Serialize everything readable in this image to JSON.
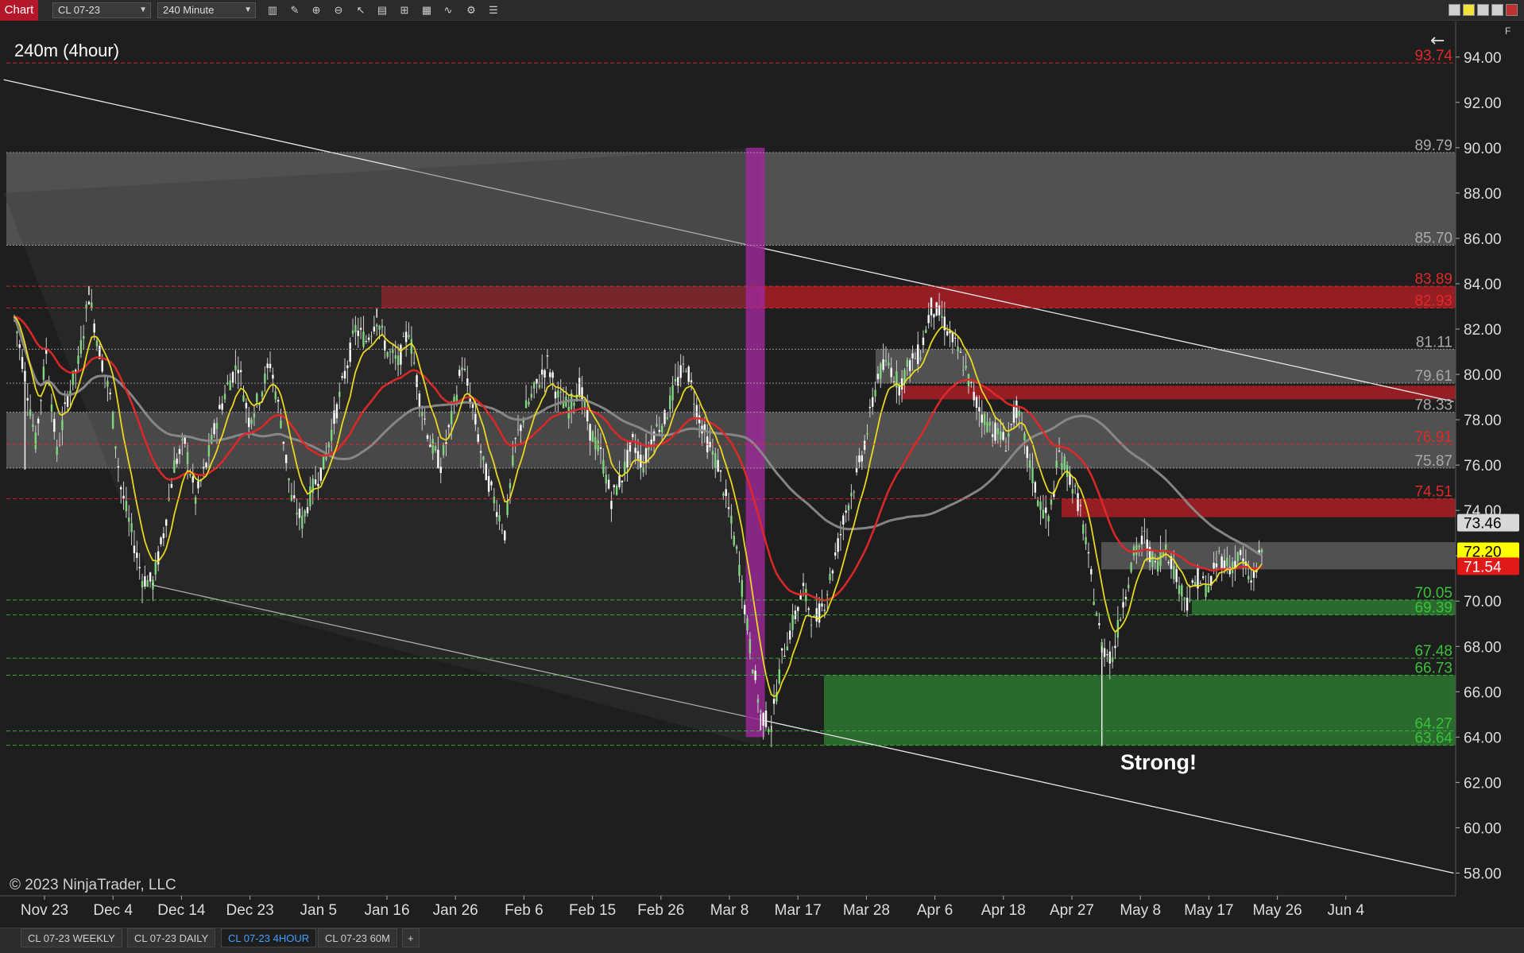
{
  "toolbar": {
    "tab_label": "Chart",
    "instrument": "CL 07-23",
    "interval": "240 Minute",
    "icons": [
      "bar-type-icon",
      "pencil-icon",
      "zoom-in-icon",
      "zoom-out-icon",
      "pointer-icon",
      "properties-icon",
      "templates-icon",
      "data-box-icon",
      "indicators-icon",
      "strategies-icon",
      "list-icon"
    ],
    "window_buttons": [
      "minimize-icon",
      "maximize-icon",
      "restore-icon",
      "close-icon"
    ]
  },
  "chart_title": "240m (4hour)",
  "copyright": "© 2023 NinjaTrader, LLC",
  "annotation": "Strong!",
  "panel_flag": "F",
  "back_icon": "back-arrow-icon",
  "colors": {
    "background": "#1e1e1e",
    "resistance": "#c81e28",
    "support": "#2e7d32",
    "neutral_zone": "#5a5a5a",
    "ema_fast": "#f0e020",
    "ema_mid": "#e02828",
    "sma_slow": "#8a8a8a",
    "highlight_bar": "#a0289c",
    "up_candle": "#7ed67e",
    "down_candle": "#ffffff"
  },
  "chart_data": {
    "type": "candlestick",
    "title": "240m (4hour)",
    "ylim": [
      57,
      95.5
    ],
    "y_ticks": [
      58,
      60,
      62,
      64,
      66,
      68,
      70,
      72,
      74,
      76,
      78,
      80,
      82,
      84,
      86,
      88,
      90,
      92,
      94
    ],
    "y_tick_labels": [
      "58.00",
      "60.00",
      "62.00",
      "64.00",
      "66.00",
      "68.00",
      "70.00",
      "72.00",
      "74.00",
      "76.00",
      "78.00",
      "80.00",
      "82.00",
      "84.00",
      "86.00",
      "88.00",
      "90.00",
      "92.00",
      "94.00"
    ],
    "x_tick_labels": [
      "Nov 23",
      "Dec 4",
      "Dec 14",
      "Dec 23",
      "Jan 5",
      "Jan 16",
      "Jan 26",
      "Feb 6",
      "Feb 15",
      "Feb 26",
      "Mar 8",
      "Mar 17",
      "Mar 28",
      "Apr 6",
      "Apr 18",
      "Apr 27",
      "May 8",
      "May 17",
      "May 26",
      "Jun 4"
    ],
    "price_path": [
      [
        0,
        82.5
      ],
      [
        2,
        80
      ],
      [
        4,
        77
      ],
      [
        6,
        81
      ],
      [
        8,
        76.5
      ],
      [
        10,
        79
      ],
      [
        12,
        80.5
      ],
      [
        14,
        83.5
      ],
      [
        16,
        81
      ],
      [
        18,
        79
      ],
      [
        20,
        75
      ],
      [
        22,
        73
      ],
      [
        24,
        71
      ],
      [
        26,
        70.8
      ],
      [
        28,
        73
      ],
      [
        30,
        76
      ],
      [
        32,
        77
      ],
      [
        34,
        74.5
      ],
      [
        36,
        76
      ],
      [
        38,
        78
      ],
      [
        40,
        79.5
      ],
      [
        42,
        80.5
      ],
      [
        44,
        78
      ],
      [
        46,
        79
      ],
      [
        48,
        80.5
      ],
      [
        50,
        78
      ],
      [
        52,
        74.5
      ],
      [
        54,
        73.5
      ],
      [
        56,
        75
      ],
      [
        58,
        76
      ],
      [
        60,
        78
      ],
      [
        62,
        80
      ],
      [
        64,
        82
      ],
      [
        66,
        81.5
      ],
      [
        68,
        82.5
      ],
      [
        70,
        81
      ],
      [
        72,
        80.5
      ],
      [
        74,
        82
      ],
      [
        76,
        79
      ],
      [
        78,
        77
      ],
      [
        80,
        76
      ],
      [
        82,
        78
      ],
      [
        84,
        80.5
      ],
      [
        86,
        78.5
      ],
      [
        88,
        76
      ],
      [
        90,
        74.5
      ],
      [
        92,
        73
      ],
      [
        94,
        77
      ],
      [
        96,
        78.5
      ],
      [
        98,
        79.5
      ],
      [
        100,
        80.5
      ],
      [
        102,
        79
      ],
      [
        104,
        78.5
      ],
      [
        106,
        79.5
      ],
      [
        108,
        77.5
      ],
      [
        110,
        76.5
      ],
      [
        112,
        74.5
      ],
      [
        114,
        75.5
      ],
      [
        116,
        77
      ],
      [
        118,
        76
      ],
      [
        120,
        77.5
      ],
      [
        122,
        78
      ],
      [
        124,
        79.5
      ],
      [
        126,
        80.5
      ],
      [
        128,
        78.5
      ],
      [
        130,
        77
      ],
      [
        132,
        76
      ],
      [
        134,
        74
      ],
      [
        136,
        71.5
      ],
      [
        138,
        68
      ],
      [
        140,
        65
      ],
      [
        142,
        64.5
      ],
      [
        144,
        67.5
      ],
      [
        146,
        69
      ],
      [
        148,
        70.5
      ],
      [
        150,
        69
      ],
      [
        152,
        70
      ],
      [
        154,
        72
      ],
      [
        156,
        74
      ],
      [
        158,
        75.5
      ],
      [
        160,
        77.5
      ],
      [
        162,
        80
      ],
      [
        164,
        80.5
      ],
      [
        166,
        79.5
      ],
      [
        168,
        80.5
      ],
      [
        170,
        81
      ],
      [
        172,
        83
      ],
      [
        174,
        82.5
      ],
      [
        176,
        81.5
      ],
      [
        178,
        80.5
      ],
      [
        180,
        79
      ],
      [
        182,
        78
      ],
      [
        184,
        77.5
      ],
      [
        186,
        77
      ],
      [
        188,
        78.5
      ],
      [
        190,
        76.5
      ],
      [
        192,
        74.5
      ],
      [
        194,
        73.5
      ],
      [
        196,
        76.5
      ],
      [
        198,
        75.5
      ],
      [
        200,
        74
      ],
      [
        202,
        71
      ],
      [
        204,
        68
      ],
      [
        206,
        67.5
      ],
      [
        208,
        70
      ],
      [
        210,
        72
      ],
      [
        212,
        72.8
      ],
      [
        214,
        71.5
      ],
      [
        216,
        72.5
      ],
      [
        218,
        71
      ],
      [
        220,
        70
      ],
      [
        222,
        71
      ],
      [
        224,
        70.5
      ],
      [
        226,
        72
      ],
      [
        228,
        71.5
      ],
      [
        230,
        72
      ],
      [
        232,
        70.8
      ],
      [
        234,
        72.2
      ]
    ],
    "wick_extremes": [
      {
        "bar": 2,
        "low": 75.8
      },
      {
        "bar": 14,
        "high": 83.9
      },
      {
        "bar": 26,
        "low": 70.7
      },
      {
        "bar": 68,
        "high": 82.9
      },
      {
        "bar": 140,
        "low": 64.3
      },
      {
        "bar": 142,
        "low": 64.3
      },
      {
        "bar": 172,
        "high": 83.2
      },
      {
        "bar": 204,
        "low": 63.6
      }
    ],
    "series": [
      {
        "name": "",
        "color": "#f0e020",
        "period_type": "fast"
      },
      {
        "name": "",
        "color": "#e02828",
        "period_type": "mid"
      },
      {
        "name": "",
        "color": "#8a8a8a",
        "period_type": "slow"
      }
    ],
    "zones": [
      {
        "kind": "neutral",
        "from": 85.7,
        "to": 89.79
      },
      {
        "kind": "neutral",
        "from": 75.87,
        "to": 78.33
      },
      {
        "kind": "neutral",
        "from": 79.61,
        "to": 81.11
      },
      {
        "kind": "resistance",
        "from": 82.93,
        "to": 83.89
      },
      {
        "kind": "resistance",
        "from": 78.9,
        "to": 79.5
      },
      {
        "kind": "resistance",
        "from": 73.7,
        "to": 74.51
      },
      {
        "kind": "neutral",
        "from": 71.4,
        "to": 72.6
      },
      {
        "kind": "support",
        "from": 69.39,
        "to": 70.05
      },
      {
        "kind": "support",
        "from": 63.64,
        "to": 66.73
      }
    ],
    "levels": [
      {
        "value": 93.74,
        "label": "93.74",
        "kind": "resistance"
      },
      {
        "value": 89.79,
        "label": "89.79",
        "kind": "neutral"
      },
      {
        "value": 85.7,
        "label": "85.70",
        "kind": "neutral"
      },
      {
        "value": 83.89,
        "label": "83.89",
        "kind": "resistance"
      },
      {
        "value": 82.93,
        "label": "82.93",
        "kind": "resistance"
      },
      {
        "value": 81.11,
        "label": "81.11",
        "kind": "neutral"
      },
      {
        "value": 79.61,
        "label": "79.61",
        "kind": "neutral"
      },
      {
        "value": 78.33,
        "label": "78.33",
        "kind": "neutral"
      },
      {
        "value": 76.91,
        "label": "76.91",
        "kind": "resistance"
      },
      {
        "value": 75.87,
        "label": "75.87",
        "kind": "neutral"
      },
      {
        "value": 74.51,
        "label": "74.51",
        "kind": "resistance"
      },
      {
        "value": 70.05,
        "label": "70.05",
        "kind": "support"
      },
      {
        "value": 69.39,
        "label": "69.39",
        "kind": "support"
      },
      {
        "value": 67.48,
        "label": "67.48",
        "kind": "support"
      },
      {
        "value": 66.73,
        "label": "66.73",
        "kind": "support"
      },
      {
        "value": 64.27,
        "label": "64.27",
        "kind": "support"
      },
      {
        "value": 63.64,
        "label": "63.64",
        "kind": "support"
      }
    ],
    "price_markers": [
      {
        "value": 73.46,
        "label": "73.46",
        "bg": "#d8d8d8",
        "fg": "#000000"
      },
      {
        "value": 72.2,
        "label": "72.20",
        "bg": "#ffff00",
        "fg": "#000000"
      },
      {
        "value": 71.54,
        "label": "71.54",
        "bg": "#e01818",
        "fg": "#ffffff"
      }
    ],
    "channel": {
      "upper_start": {
        "bar": -2,
        "price": 93.0
      },
      "upper_end": {
        "bar": 270,
        "price": 78.8
      },
      "lower_start": {
        "bar": 26,
        "price": 70.7
      },
      "lower_end": {
        "bar": 270,
        "price": 58.0
      }
    },
    "highlight_bar_index": 139
  },
  "bottom_tabs": [
    {
      "label": "CL 07-23 WEEKLY",
      "active": false
    },
    {
      "label": "CL 07-23 DAILY",
      "active": false
    },
    {
      "label": "CL 07-23 4HOUR",
      "active": true
    },
    {
      "label": "CL 07-23 60M",
      "active": false
    }
  ],
  "add_tab_label": "+"
}
